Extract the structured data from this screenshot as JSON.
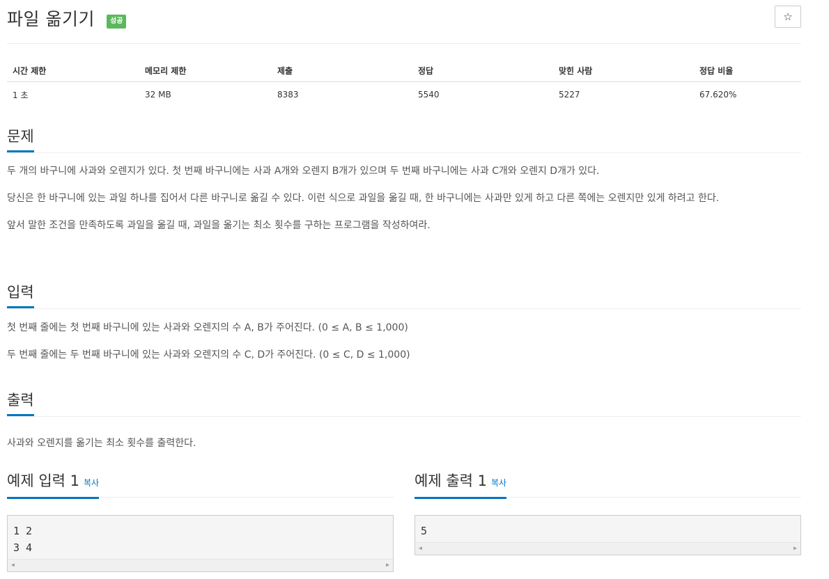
{
  "problem": {
    "title": "파일 옮기기",
    "badge": "성공",
    "star_icon": "☆"
  },
  "info_table": {
    "headers": [
      "시간 제한",
      "메모리 제한",
      "제출",
      "정답",
      "맞힌 사람",
      "정답 비율"
    ],
    "values": [
      "1 초",
      "32 MB",
      "8383",
      "5540",
      "5227",
      "67.620%"
    ]
  },
  "sections": {
    "description": {
      "heading": "문제",
      "paragraphs": [
        "두 개의 바구니에 사과와 오렌지가 있다. 첫 번째 바구니에는 사과 A개와 오렌지 B개가 있으며 두 번째 바구니에는 사과 C개와 오렌지 D개가 있다.",
        "당신은 한 바구니에 있는 과일 하나를 집어서 다른 바구니로 옮길 수 있다. 이런 식으로 과일을 옮길 때, 한 바구니에는 사과만 있게 하고 다른 쪽에는 오렌지만 있게 하려고 한다.",
        "앞서 말한 조건을 만족하도록 과일을 옮길 때, 과일을 옮기는 최소 횟수를 구하는 프로그램을 작성하여라."
      ]
    },
    "input": {
      "heading": "입력",
      "paragraphs": [
        "첫 번째 줄에는 첫 번째 바구니에 있는 사과와 오렌지의 수 A, B가 주어진다. (0 ≤ A, B ≤ 1,000)",
        "두 번째 줄에는 두 번째 바구니에 있는 사과와 오렌지의 수 C, D가 주어진다. (0 ≤ C, D ≤ 1,000)"
      ]
    },
    "output": {
      "heading": "출력",
      "paragraphs": [
        "사과와 오렌지를 옮기는 최소 횟수를 출력한다."
      ]
    }
  },
  "samples": {
    "input": {
      "heading": "예제 입력 1",
      "copy_label": "복사",
      "content": "1 2\n3 4"
    },
    "output": {
      "heading": "예제 출력 1",
      "copy_label": "복사",
      "content": "5"
    }
  }
}
